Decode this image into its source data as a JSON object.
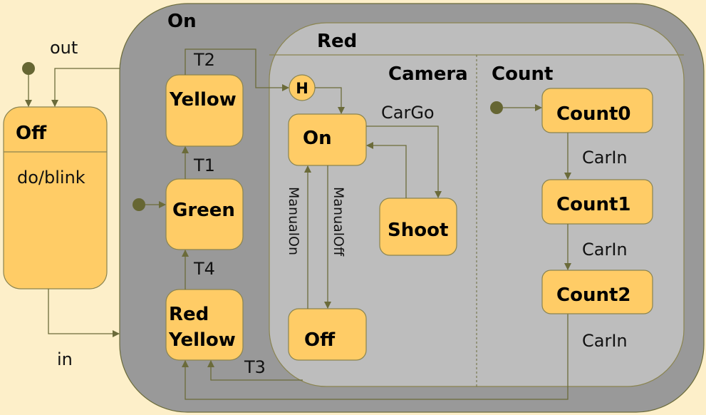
{
  "colors": {
    "background": "#fdefc9",
    "outer_region": "#999999",
    "inner_region": "#bdbdbd",
    "state_fill": "#ffcc66",
    "line": "#6b6b3a"
  },
  "off_state": {
    "name": "Off",
    "activity": "do/blink"
  },
  "transitions_outer": {
    "out": "out",
    "in": "in"
  },
  "on_state": {
    "name": "On",
    "substates": {
      "yellow": "Yellow",
      "green": "Green",
      "red_yellow_1": "Red",
      "red_yellow_2": "Yellow"
    },
    "transitions": {
      "t1": "T1",
      "t2": "T2",
      "t3": "T3",
      "t4": "T4"
    }
  },
  "red_state": {
    "name": "Red",
    "history": "H",
    "camera": {
      "name": "Camera",
      "on": "On",
      "off": "Off",
      "shoot": "Shoot",
      "cargo": "CarGo",
      "manual_on": "ManualOn",
      "manual_off": "ManualOff"
    },
    "count": {
      "name": "Count",
      "states": [
        "Count0",
        "Count1",
        "Count2"
      ],
      "carin": [
        "CarIn",
        "CarIn",
        "CarIn"
      ]
    }
  }
}
